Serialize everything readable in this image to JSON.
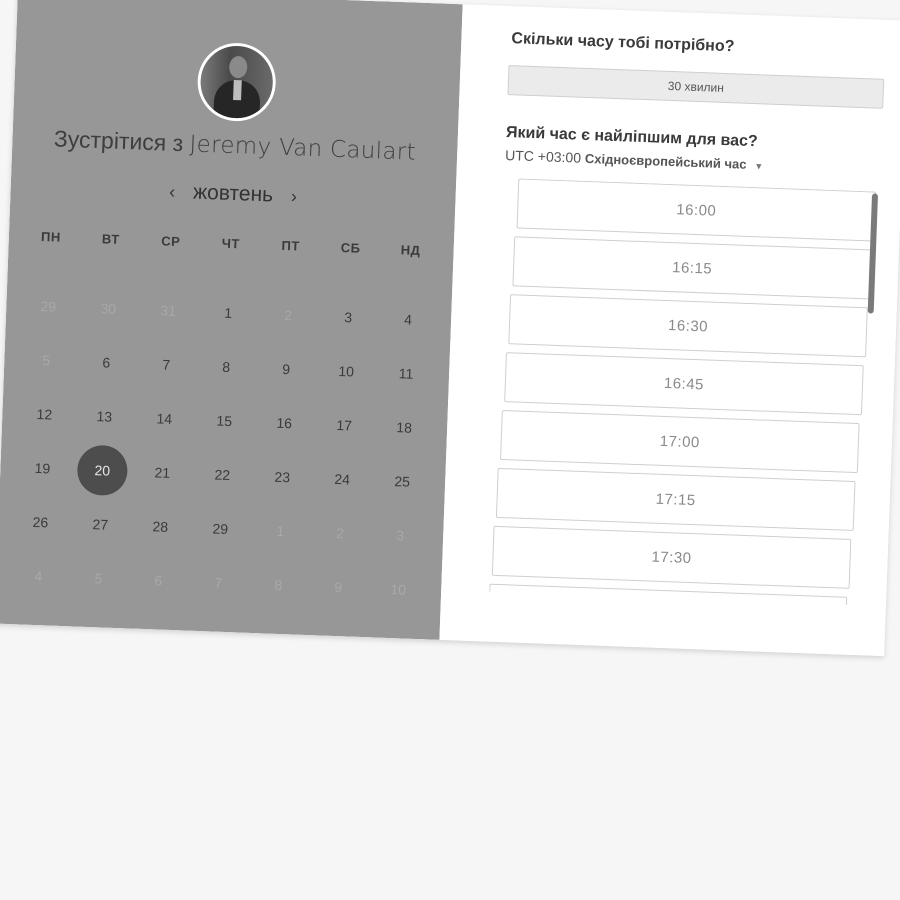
{
  "booking": {
    "left": {
      "title_prefix": "Зустрітися з",
      "host_name": "Jeremy Van Caulart",
      "month": "жовтень",
      "prev_icon": "‹",
      "next_icon": "›",
      "weekdays": [
        "ПН",
        "ВТ",
        "СР",
        "ЧТ",
        "ПТ",
        "СБ",
        "НД"
      ],
      "days": [
        {
          "d": "29",
          "muted": true
        },
        {
          "d": "30",
          "muted": true
        },
        {
          "d": "31",
          "muted": true
        },
        {
          "d": "1"
        },
        {
          "d": "2",
          "muted": true
        },
        {
          "d": "3"
        },
        {
          "d": "4"
        },
        {
          "d": "5",
          "muted": true
        },
        {
          "d": "6"
        },
        {
          "d": "7"
        },
        {
          "d": "8"
        },
        {
          "d": "9"
        },
        {
          "d": "10"
        },
        {
          "d": "11"
        },
        {
          "d": "12"
        },
        {
          "d": "13"
        },
        {
          "d": "14"
        },
        {
          "d": "15"
        },
        {
          "d": "16"
        },
        {
          "d": "17"
        },
        {
          "d": "18"
        },
        {
          "d": "19"
        },
        {
          "d": "20",
          "selected": true
        },
        {
          "d": "21"
        },
        {
          "d": "22"
        },
        {
          "d": "23"
        },
        {
          "d": "24"
        },
        {
          "d": "25"
        },
        {
          "d": "26"
        },
        {
          "d": "27"
        },
        {
          "d": "28"
        },
        {
          "d": "29"
        },
        {
          "d": "1",
          "muted": true
        },
        {
          "d": "2",
          "muted": true
        },
        {
          "d": "3",
          "muted": true
        },
        {
          "d": "4",
          "muted": true
        },
        {
          "d": "5",
          "muted": true
        },
        {
          "d": "6",
          "muted": true
        },
        {
          "d": "7",
          "muted": true
        },
        {
          "d": "8",
          "muted": true
        },
        {
          "d": "9",
          "muted": true
        },
        {
          "d": "10",
          "muted": true
        }
      ]
    },
    "right": {
      "duration_question": "Скільки часу тобі потрібно?",
      "duration_value": "30 хвилин",
      "time_question": "Який час є найліпшим для вас?",
      "tz_offset": "UTC +03:00",
      "tz_name": "Східноєвропейський час",
      "tz_caret": "▼",
      "slots": [
        "16:00",
        "16:15",
        "16:30",
        "16:45",
        "17:00",
        "17:15",
        "17:30",
        ""
      ]
    }
  }
}
